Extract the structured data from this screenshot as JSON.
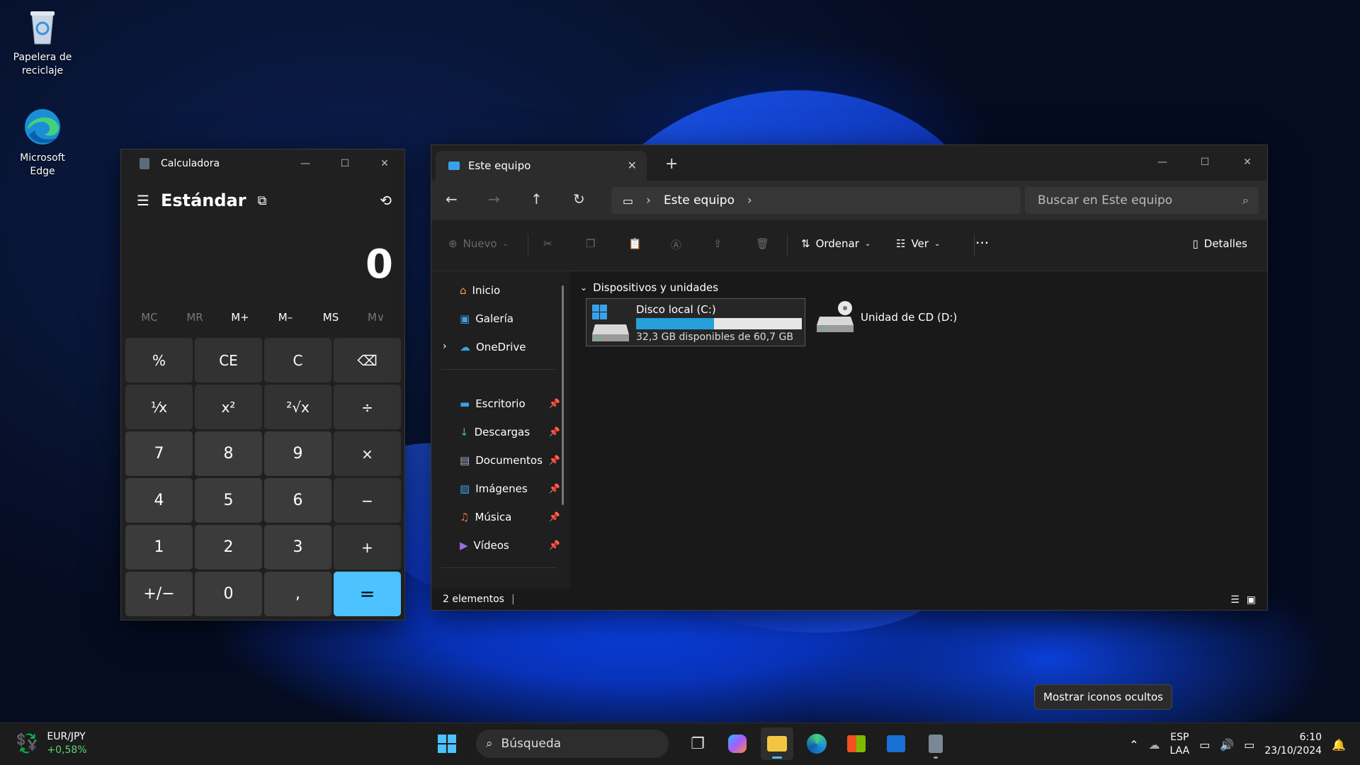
{
  "desktop": {
    "icons": [
      {
        "label": "Papelera de reciclaje",
        "icon": "recycle-bin-icon"
      },
      {
        "label": "Microsoft Edge",
        "icon": "edge-icon"
      }
    ]
  },
  "calculator": {
    "title": "Calculadora",
    "mode": "Estándar",
    "display": "0",
    "memory": [
      "MC",
      "MR",
      "M+",
      "M–",
      "MS",
      "M∨"
    ],
    "keys": [
      "%",
      "CE",
      "C",
      "⌫",
      "¹⁄x",
      "x²",
      "²√x",
      "÷",
      "7",
      "8",
      "9",
      "×",
      "4",
      "5",
      "6",
      "−",
      "1",
      "2",
      "3",
      "+",
      "+/−",
      "0",
      ",",
      "="
    ],
    "accent": "#4cc2ff"
  },
  "explorer": {
    "tab_title": "Este equipo",
    "breadcrumb": "Este equipo",
    "search_placeholder": "Buscar en Este equipo",
    "toolbar": {
      "new": "Nuevo",
      "sort": "Ordenar",
      "view": "Ver",
      "details": "Detalles"
    },
    "sidebar": {
      "items": [
        "Inicio",
        "Galería",
        "OneDrive"
      ],
      "pinned": [
        "Escritorio",
        "Descargas",
        "Documentos",
        "Imágenes",
        "Música",
        "Vídeos"
      ]
    },
    "group": "Dispositivos y unidades",
    "drives": [
      {
        "name": "Disco local (C:)",
        "free_text": "32,3 GB disponibles de 60,7 GB",
        "used_fraction": 0.47
      },
      {
        "name": "Unidad de CD (D:)"
      }
    ],
    "status": "2 elementos"
  },
  "tooltip": "Mostrar iconos ocultos",
  "taskbar": {
    "widget": {
      "pair": "EUR/JPY",
      "change": "+0,58%"
    },
    "search": "Búsqueda",
    "lang_top": "ESP",
    "lang_bottom": "LAA",
    "time": "6:10",
    "date": "23/10/2024"
  }
}
